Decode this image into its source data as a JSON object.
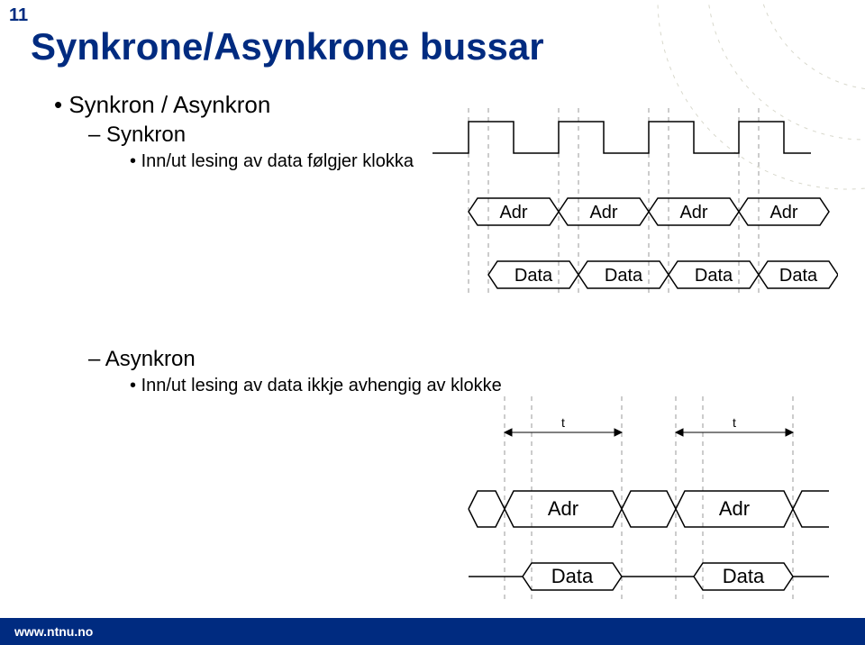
{
  "page_number": "11",
  "title": "Synkrone/Asynkrone bussar",
  "bullets": {
    "main": "Synkron / Asynkron",
    "sync_label": "Synkron",
    "sync_detail": "Inn/ut lesing av data følgjer klokka",
    "async_label": "Asynkron",
    "async_detail": "Inn/ut lesing av data ikkje avhengig av klokke"
  },
  "diagram_labels": {
    "adr": "Adr",
    "data": "Data",
    "t": "t"
  },
  "footer": "www.ntnu.no"
}
